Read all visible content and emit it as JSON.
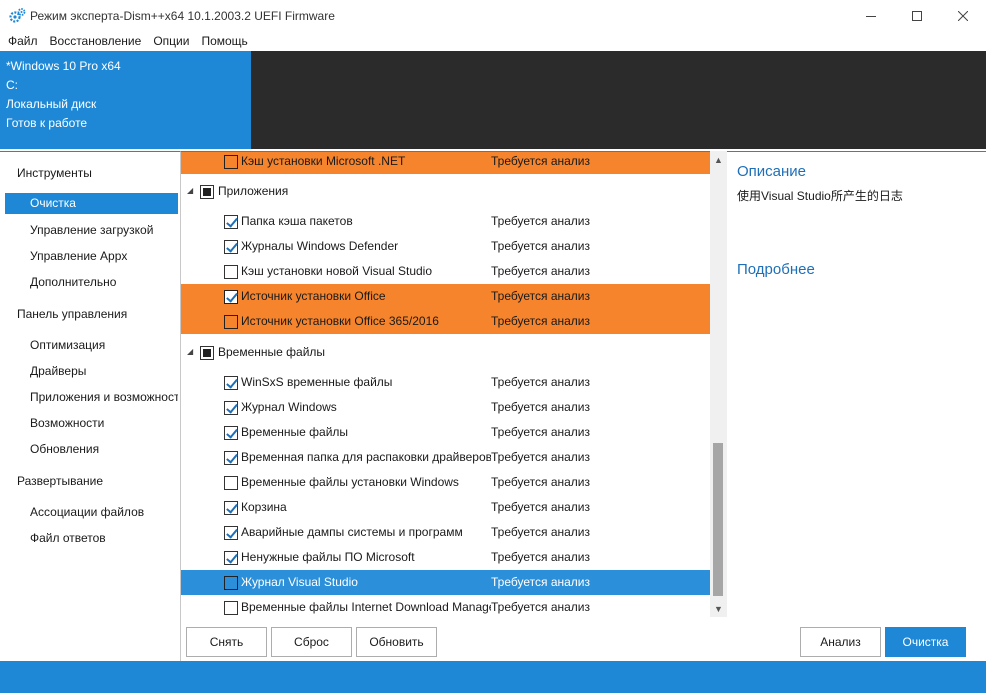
{
  "window": {
    "title": "Режим эксперта-Dism++x64 10.1.2003.2 UEFI Firmware",
    "min_icon": "minimize-icon",
    "max_icon": "maximize-icon",
    "close_icon": "close-icon"
  },
  "menu": [
    "Файл",
    "Восстановление",
    "Опции",
    "Помощь"
  ],
  "info": {
    "os": "*Windows 10 Pro x64",
    "drive": "C:",
    "disk": "Локальный диск",
    "status": "Готов к работе"
  },
  "sidebar": {
    "groups": [
      {
        "label": "Инструменты",
        "items": [
          "Очистка",
          "Управление загрузкой",
          "Управление Appx",
          "Дополнительно"
        ]
      },
      {
        "label": "Панель управления",
        "items": [
          "Оптимизация",
          "Драйверы",
          "Приложения и возможности",
          "Возможности",
          "Обновления"
        ]
      },
      {
        "label": "Развертывание",
        "items": [
          "Ассоциации файлов",
          "Файл ответов"
        ]
      }
    ],
    "selected": "Очистка"
  },
  "list": {
    "groups": {
      "apps": "Приложения",
      "temp": "Временные файлы"
    },
    "rows": [
      {
        "label": "Кэш установки Microsoft .NET",
        "status": "Требуется анализ",
        "checked": false,
        "highlight": "orange"
      },
      {
        "label": "Папка кэша пакетов",
        "status": "Требуется анализ",
        "checked": true,
        "highlight": "none"
      },
      {
        "label": "Журналы Windows Defender",
        "status": "Требуется анализ",
        "checked": true,
        "highlight": "none"
      },
      {
        "label": "Кэш установки новой Visual Studio",
        "status": "Требуется анализ",
        "checked": false,
        "highlight": "none"
      },
      {
        "label": "Источник установки Office",
        "status": "Требуется анализ",
        "checked": true,
        "highlight": "orange"
      },
      {
        "label": "Источник установки Office 365/2016",
        "status": "Требуется анализ",
        "checked": false,
        "highlight": "orange"
      },
      {
        "label": "WinSxS временные файлы",
        "status": "Требуется анализ",
        "checked": true,
        "highlight": "none"
      },
      {
        "label": "Журнал Windows",
        "status": "Требуется анализ",
        "checked": true,
        "highlight": "none"
      },
      {
        "label": "Временные файлы",
        "status": "Требуется анализ",
        "checked": true,
        "highlight": "none"
      },
      {
        "label": "Временная папка для распаковки драйверов",
        "status": "Требуется анализ",
        "checked": true,
        "highlight": "none"
      },
      {
        "label": "Временные файлы установки Windows",
        "status": "Требуется анализ",
        "checked": false,
        "highlight": "none"
      },
      {
        "label": "Корзина",
        "status": "Требуется анализ",
        "checked": true,
        "highlight": "none"
      },
      {
        "label": "Аварийные дампы системы и программ",
        "status": "Требуется анализ",
        "checked": true,
        "highlight": "none"
      },
      {
        "label": "Ненужные файлы ПО Microsoft",
        "status": "Требуется анализ",
        "checked": true,
        "highlight": "none"
      },
      {
        "label": "Журнал Visual Studio",
        "status": "Требуется анализ",
        "checked": false,
        "highlight": "blue"
      },
      {
        "label": "Временные файлы Internet Download Manager",
        "status": "Требуется анализ",
        "checked": false,
        "highlight": "none"
      }
    ]
  },
  "details": {
    "title": "Описание",
    "text": "使用Visual Studio所产生的日志",
    "more": "Подробнее"
  },
  "buttons": {
    "remove": "Снять",
    "reset": "Сброс",
    "refresh": "Обновить",
    "analyze": "Анализ",
    "clean": "Очистка"
  },
  "colors": {
    "accent": "#1e88d6",
    "highlight_orange": "#f5842c",
    "selection_blue": "#2b8fd9",
    "dark_panel": "#2b2b2b"
  }
}
